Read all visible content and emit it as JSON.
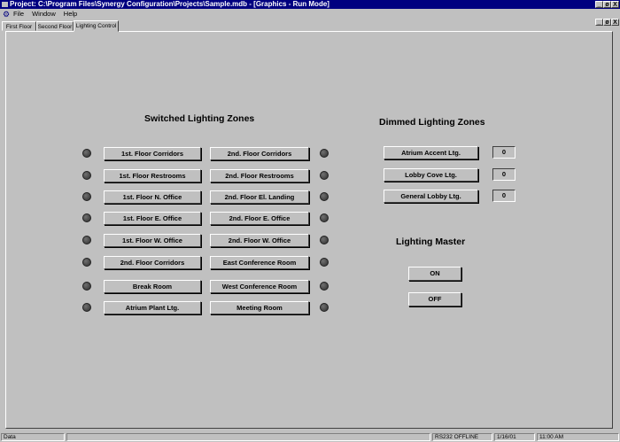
{
  "window": {
    "title": "Project: C:\\Program Files\\Synergy Configuration\\Projects\\Sample.mdb - [Graphics - Run Mode]",
    "controls": [
      "_",
      "ø",
      "X"
    ]
  },
  "menubar": {
    "items": [
      "File",
      "Window",
      "Help"
    ],
    "mdi_controls": [
      "_",
      "ø",
      "X"
    ]
  },
  "tabs": [
    {
      "label": "First Floor"
    },
    {
      "label": "Second Floor"
    },
    {
      "label": "Lighting Control"
    }
  ],
  "switched": {
    "heading": "Switched Lighting Zones",
    "left": [
      "1st. Floor Corridors",
      "1st. Floor Restrooms",
      "1st. Floor N. Office",
      "1st. Floor E. Office",
      "1st. Floor W. Office",
      "2nd. Floor Corridors",
      "Break Room",
      "Atrium Plant Ltg."
    ],
    "right": [
      "2nd. Floor Corridors",
      "2nd. Floor Restrooms",
      "2nd. Floor El. Landing",
      "2nd. Floor E. Office",
      "2nd. Floor W. Office",
      "East Conference Room",
      "West Conference Room",
      "Meeting Room"
    ]
  },
  "dimmed": {
    "heading": "Dimmed Lighting Zones",
    "zones": [
      {
        "label": "Atrium Accent Ltg.",
        "value": "0"
      },
      {
        "label": "Lobby Cove Ltg.",
        "value": "0"
      },
      {
        "label": "General Lobby Ltg.",
        "value": "0"
      }
    ]
  },
  "master": {
    "heading": "Lighting Master",
    "on_label": "ON",
    "off_label": "OFF"
  },
  "status": {
    "left": "Data",
    "port": "RS232 OFFLINE",
    "date": "1/16/01",
    "time": "11:00 AM"
  }
}
